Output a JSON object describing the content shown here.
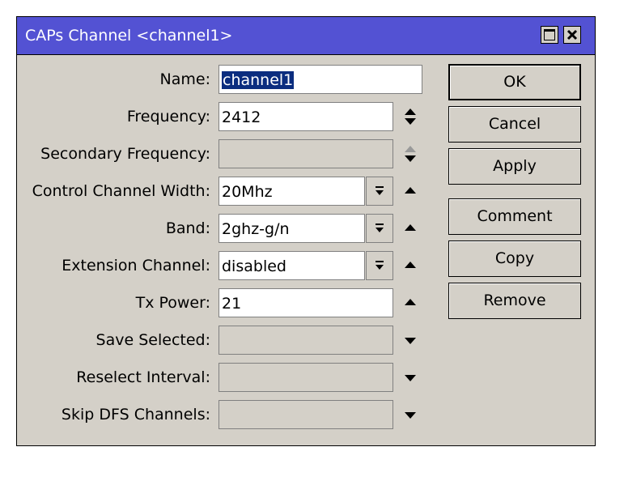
{
  "window": {
    "title": "CAPs Channel <channel1>"
  },
  "fields": {
    "name": {
      "label": "Name:",
      "value": "channel1"
    },
    "frequency": {
      "label": "Frequency:",
      "value": "2412"
    },
    "secondary_frequency": {
      "label": "Secondary Frequency:",
      "value": ""
    },
    "control_channel_width": {
      "label": "Control Channel Width:",
      "value": "20Mhz"
    },
    "band": {
      "label": "Band:",
      "value": "2ghz-g/n"
    },
    "extension_channel": {
      "label": "Extension Channel:",
      "value": "disabled"
    },
    "tx_power": {
      "label": "Tx Power:",
      "value": "21"
    },
    "save_selected": {
      "label": "Save Selected:",
      "value": ""
    },
    "reselect_interval": {
      "label": "Reselect Interval:",
      "value": ""
    },
    "skip_dfs_channels": {
      "label": "Skip DFS Channels:",
      "value": ""
    }
  },
  "buttons": {
    "ok": "OK",
    "cancel": "Cancel",
    "apply": "Apply",
    "comment": "Comment",
    "copy": "Copy",
    "remove": "Remove"
  },
  "icons": {
    "maximize": "maximize-icon",
    "close": "close-icon",
    "spin": "up-down-arrows-icon",
    "collapse": "triangle-up-icon",
    "expand": "triangle-down-icon",
    "dropdown": "dropdown-arrow-icon"
  }
}
